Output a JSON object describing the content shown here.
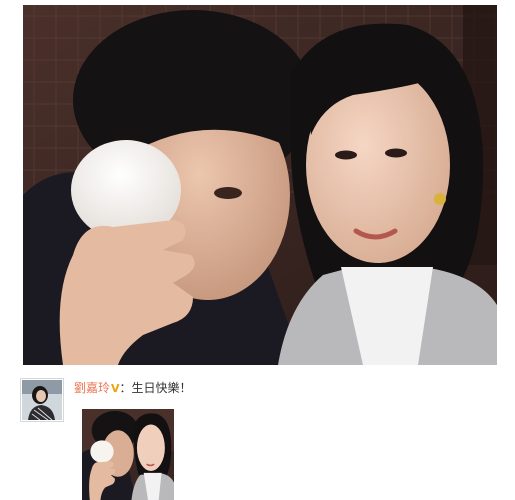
{
  "post": {
    "author_name": "劉嘉玲",
    "verified_badge": "V",
    "colon": "：",
    "message": "生日快樂！"
  },
  "icons": {
    "verified": "vip-v-icon"
  },
  "colors": {
    "author_link": "#eb7350",
    "vip_badge": "#f0a30a",
    "message_text": "#333333"
  }
}
